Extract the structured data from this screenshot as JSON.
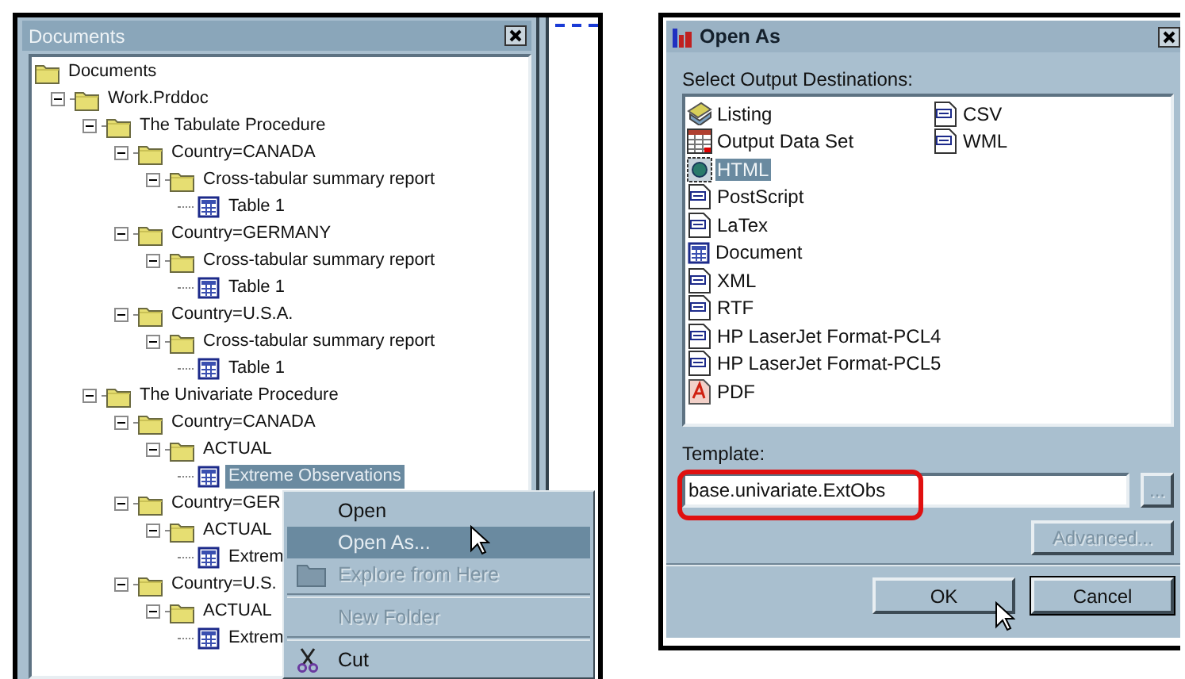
{
  "documents_panel": {
    "title": "Documents",
    "tree": [
      {
        "label": "Documents",
        "kind": "folder",
        "selected": false,
        "children": [
          {
            "label": "Work.Prddoc",
            "kind": "folder",
            "expanded": true,
            "selected": false,
            "children": [
              {
                "label": "The Tabulate Procedure",
                "kind": "folder",
                "expanded": true,
                "selected": false,
                "children": [
                  {
                    "label": "Country=CANADA",
                    "kind": "folder",
                    "expanded": true,
                    "selected": false,
                    "children": [
                      {
                        "label": "Cross-tabular summary report",
                        "kind": "folder",
                        "expanded": true,
                        "selected": false,
                        "children": [
                          {
                            "label": "Table 1",
                            "kind": "table",
                            "selected": false
                          }
                        ]
                      }
                    ]
                  },
                  {
                    "label": "Country=GERMANY",
                    "kind": "folder",
                    "expanded": true,
                    "selected": false,
                    "children": [
                      {
                        "label": "Cross-tabular summary report",
                        "kind": "folder",
                        "expanded": true,
                        "selected": false,
                        "children": [
                          {
                            "label": "Table 1",
                            "kind": "table",
                            "selected": false
                          }
                        ]
                      }
                    ]
                  },
                  {
                    "label": "Country=U.S.A.",
                    "kind": "folder",
                    "expanded": true,
                    "selected": false,
                    "children": [
                      {
                        "label": "Cross-tabular summary report",
                        "kind": "folder",
                        "expanded": true,
                        "selected": false,
                        "children": [
                          {
                            "label": "Table 1",
                            "kind": "table",
                            "selected": false
                          }
                        ]
                      }
                    ]
                  }
                ]
              },
              {
                "label": "The Univariate Procedure",
                "kind": "folder",
                "expanded": true,
                "selected": false,
                "children": [
                  {
                    "label": "Country=CANADA",
                    "kind": "folder",
                    "expanded": true,
                    "selected": false,
                    "children": [
                      {
                        "label": "ACTUAL",
                        "kind": "folder",
                        "expanded": true,
                        "selected": false,
                        "children": [
                          {
                            "label": "Extreme Observations",
                            "kind": "table",
                            "selected": true
                          }
                        ]
                      }
                    ]
                  },
                  {
                    "label": "Country=GER",
                    "kind": "folder",
                    "expanded": true,
                    "selected": false,
                    "children": [
                      {
                        "label": "ACTUAL",
                        "kind": "folder",
                        "expanded": true,
                        "selected": false,
                        "children": [
                          {
                            "label": "Extrem",
                            "kind": "table",
                            "selected": false
                          }
                        ]
                      }
                    ]
                  },
                  {
                    "label": "Country=U.S.",
                    "kind": "folder",
                    "expanded": true,
                    "selected": false,
                    "children": [
                      {
                        "label": "ACTUAL",
                        "kind": "folder",
                        "expanded": true,
                        "selected": false,
                        "children": [
                          {
                            "label": "Extrem",
                            "kind": "table",
                            "selected": false
                          }
                        ]
                      }
                    ]
                  }
                ]
              }
            ]
          }
        ]
      }
    ]
  },
  "context_menu": {
    "items": [
      {
        "kind": "command",
        "label": "Open",
        "disabled": false,
        "selected": false
      },
      {
        "kind": "command",
        "label": "Open As...",
        "disabled": false,
        "selected": true
      },
      {
        "kind": "folder_command",
        "label": "Explore from Here",
        "disabled": true,
        "selected": false
      },
      {
        "kind": "separator"
      },
      {
        "kind": "command",
        "label": "New Folder",
        "disabled": true,
        "selected": false
      },
      {
        "kind": "separator"
      },
      {
        "kind": "cut_command",
        "label": "Cut",
        "disabled": false,
        "selected": false
      }
    ]
  },
  "open_as_dialog": {
    "title": "Open As",
    "destinations_label": "Select Output Destinations:",
    "destinations": [
      [
        {
          "kind": "listing",
          "label": "Listing",
          "selected": false
        },
        {
          "kind": "dataset",
          "label": "Output Data Set",
          "selected": false
        },
        {
          "kind": "html",
          "label": "HTML",
          "selected": true
        },
        {
          "kind": "file",
          "label": "PostScript",
          "selected": false
        },
        {
          "kind": "file",
          "label": "LaTex",
          "selected": false
        },
        {
          "kind": "table",
          "label": "Document",
          "selected": false
        },
        {
          "kind": "file",
          "label": "XML",
          "selected": false
        },
        {
          "kind": "file",
          "label": "RTF",
          "selected": false
        },
        {
          "kind": "file",
          "label": "HP LaserJet Format-PCL4",
          "selected": false
        },
        {
          "kind": "file",
          "label": "HP LaserJet Format-PCL5",
          "selected": false
        },
        {
          "kind": "pdf",
          "label": "PDF",
          "selected": false
        }
      ],
      [
        {
          "kind": "file",
          "label": "CSV",
          "selected": false
        },
        {
          "kind": "file",
          "label": "WML",
          "selected": false
        }
      ]
    ],
    "template": {
      "label": "Template:",
      "value": "base.univariate.ExtObs",
      "highlighted": true
    },
    "browse_button": {
      "label": "...",
      "disabled": true
    },
    "advanced_button": {
      "label": "Advanced...",
      "disabled": true
    },
    "buttons": [
      {
        "label": "OK",
        "default": false
      },
      {
        "label": "Cancel",
        "default": true
      }
    ]
  }
}
